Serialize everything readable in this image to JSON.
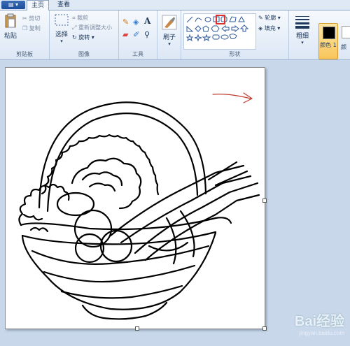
{
  "app_button": "▤ ▾",
  "tabs": [
    {
      "label": "主页"
    },
    {
      "label": "查看"
    }
  ],
  "groups": {
    "clipboard": {
      "label": "剪贴板",
      "paste": "粘贴",
      "cut": "剪切",
      "copy": "复制"
    },
    "image": {
      "label": "图像",
      "select": "选择",
      "crop": "裁剪",
      "resize": "重新调整大小",
      "rotate": "旋转"
    },
    "tools": {
      "label": "工具"
    },
    "brush": {
      "label": "刷子"
    },
    "shapes": {
      "label": "形状",
      "outline": "轮廓",
      "fill": "填充"
    },
    "size": {
      "label": "粗细"
    },
    "color1": {
      "label": "颜色 1"
    },
    "color2": {
      "label": "颜"
    }
  },
  "colors": {
    "color1": "#000000",
    "color2": "#ffffff",
    "highlight": "#e0302b",
    "arrow": "#c0392b"
  },
  "watermark": {
    "brand": "Bai经验",
    "url": "jingyan.baidu.com"
  }
}
